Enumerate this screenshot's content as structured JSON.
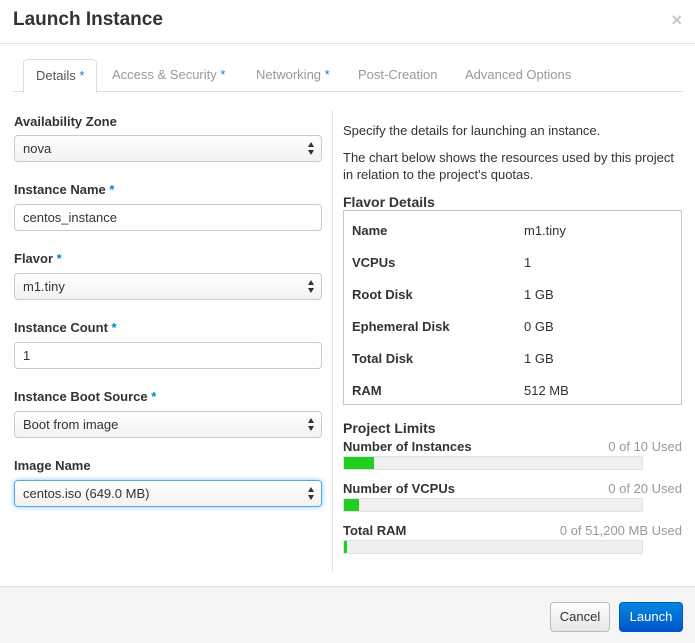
{
  "dialog": {
    "title": "Launch Instance",
    "close_glyph": "×"
  },
  "tabs": [
    {
      "label": "Details",
      "required": "*"
    },
    {
      "label": "Access & Security",
      "required": "*"
    },
    {
      "label": "Networking",
      "required": "*"
    },
    {
      "label": "Post-Creation",
      "required": ""
    },
    {
      "label": "Advanced Options",
      "required": ""
    }
  ],
  "form": {
    "availability_zone": {
      "label": "Availability Zone",
      "value": "nova"
    },
    "instance_name": {
      "label": "Instance Name",
      "required": "*",
      "value": "centos_instance"
    },
    "flavor": {
      "label": "Flavor",
      "required": "*",
      "value": "m1.tiny"
    },
    "instance_count": {
      "label": "Instance Count",
      "required": "*",
      "value": "1"
    },
    "boot_source": {
      "label": "Instance Boot Source",
      "required": "*",
      "value": "Boot from image"
    },
    "image_name": {
      "label": "Image Name",
      "value": "centos.iso (649.0 MB)"
    }
  },
  "info": {
    "line1": "Specify the details for launching an instance.",
    "line2": "The chart below shows the resources used by this project in relation to the project's quotas."
  },
  "flavor_details": {
    "title": "Flavor Details",
    "rows": [
      {
        "key": "Name",
        "value": "m1.tiny"
      },
      {
        "key": "VCPUs",
        "value": "1"
      },
      {
        "key": "Root Disk",
        "value": "1 GB"
      },
      {
        "key": "Ephemeral Disk",
        "value": "0 GB"
      },
      {
        "key": "Total Disk",
        "value": "1 GB"
      },
      {
        "key": "RAM",
        "value": "512 MB"
      }
    ]
  },
  "project_limits": {
    "title": "Project Limits",
    "items": [
      {
        "label": "Number of Instances",
        "used_text": "0 of 10 Used",
        "fill_fraction": 0.1
      },
      {
        "label": "Number of VCPUs",
        "used_text": "0 of 20 Used",
        "fill_fraction": 0.05
      },
      {
        "label": "Total RAM",
        "used_text": "0 of 51,200 MB Used",
        "fill_fraction": 0.01
      }
    ],
    "bar_color": "#20cf20"
  },
  "footer": {
    "cancel_label": "Cancel",
    "launch_label": "Launch"
  },
  "colors": {
    "accent": "#0088cc",
    "launch_button": "#0066cc"
  }
}
